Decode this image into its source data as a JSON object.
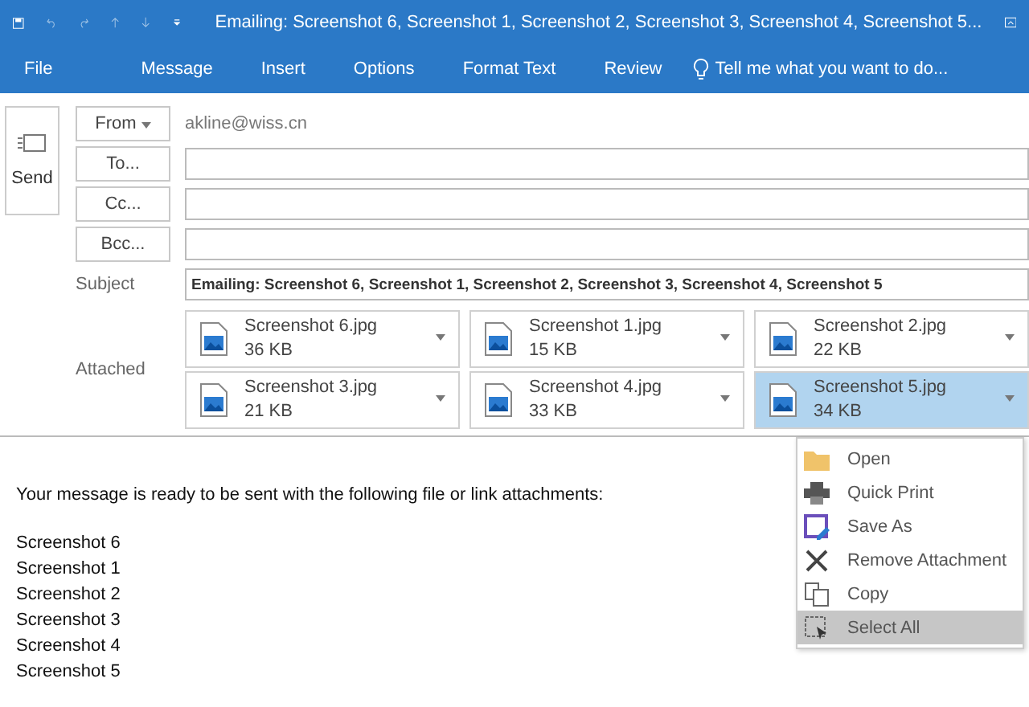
{
  "window": {
    "title": "Emailing: Screenshot 6, Screenshot 1, Screenshot 2, Screenshot 3, Screenshot 4, Screenshot 5..."
  },
  "ribbon_tabs": [
    {
      "label": "File",
      "selected": false
    },
    {
      "label": "Message",
      "selected": false
    },
    {
      "label": "Insert",
      "selected": false
    },
    {
      "label": "Options",
      "selected": false
    },
    {
      "label": "Format Text",
      "selected": false
    },
    {
      "label": "Review",
      "selected": false
    }
  ],
  "tell_me": {
    "placeholder": "Tell me what you want to do..."
  },
  "send_button": "Send",
  "from": {
    "label": "From",
    "value": "akline@wiss.cn"
  },
  "recipients": [
    {
      "label": "To..."
    },
    {
      "label": "Cc..."
    },
    {
      "label": "Bcc..."
    }
  ],
  "subject": {
    "label": "Subject",
    "value": "Emailing: Screenshot 6, Screenshot 1, Screenshot 2, Screenshot 3, Screenshot 4, Screenshot 5"
  },
  "attached_label": "Attached",
  "attachments": [
    {
      "name": "Screenshot 6.jpg",
      "size": "36 KB",
      "selected": false
    },
    {
      "name": "Screenshot 1.jpg",
      "size": "15 KB",
      "selected": false
    },
    {
      "name": "Screenshot 2.jpg",
      "size": "22 KB",
      "selected": false
    },
    {
      "name": "Screenshot 3.jpg",
      "size": "21 KB",
      "selected": false
    },
    {
      "name": "Screenshot 4.jpg",
      "size": "33 KB",
      "selected": false
    },
    {
      "name": "Screenshot 5.jpg",
      "size": "34 KB",
      "selected": true
    }
  ],
  "body": {
    "message": "Your message is ready to be sent with the following file or link attachments:",
    "lines": [
      "Screenshot 6",
      "Screenshot 1",
      "Screenshot 2",
      "Screenshot 3",
      "Screenshot 4",
      "Screenshot 5"
    ]
  },
  "context_menu": [
    {
      "kind": "open",
      "label": "Open",
      "selected": false
    },
    {
      "kind": "print",
      "label": "Quick Print",
      "selected": false
    },
    {
      "kind": "save",
      "label": "Save As",
      "selected": false
    },
    {
      "kind": "remove",
      "label": "Remove Attachment",
      "selected": false
    },
    {
      "kind": "copy",
      "label": "Copy",
      "selected": false
    },
    {
      "kind": "selectall",
      "label": "Select All",
      "selected": true
    }
  ]
}
